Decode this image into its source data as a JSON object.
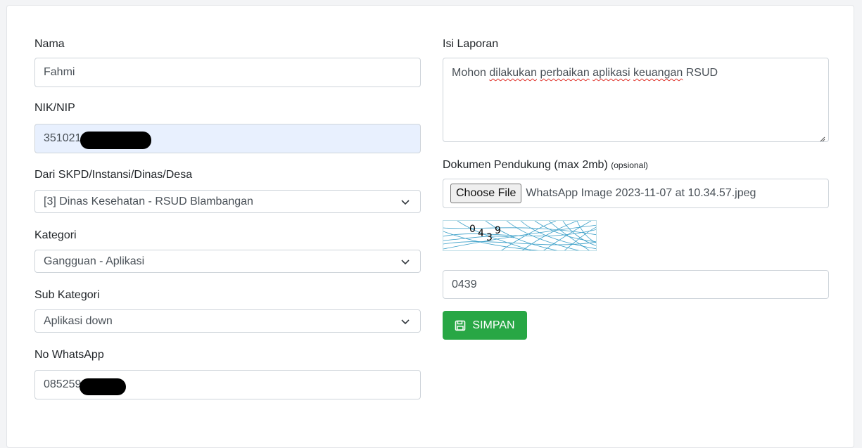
{
  "form": {
    "nama": {
      "label": "Nama",
      "value": "Fahmi"
    },
    "nik": {
      "label": "NIK/NIP",
      "value": "351021"
    },
    "skpd": {
      "label": "Dari SKPD/Instansi/Dinas/Desa",
      "value": "[3] Dinas Kesehatan - RSUD Blambangan"
    },
    "kategori": {
      "label": "Kategori",
      "value": "Gangguan - Aplikasi"
    },
    "sub_kategori": {
      "label": "Sub Kategori",
      "value": "Aplikasi down"
    },
    "whatsapp": {
      "label": "No WhatsApp",
      "value": "085259"
    },
    "isi_laporan": {
      "label": "Isi Laporan",
      "words": [
        "Mohon",
        "dilakukan",
        "perbaikan",
        "aplikasi",
        "keuangan",
        "RSUD"
      ]
    },
    "dokumen": {
      "label": "Dokumen Pendukung (max 2mb)",
      "label_note": "(opsional)",
      "button": "Choose File",
      "filename": "WhatsApp Image 2023-11-07 at 10.34.57.jpeg"
    },
    "captcha": {
      "image_text": "0439",
      "input_value": "0439"
    },
    "submit": {
      "label": "SIMPAN",
      "icon": "save-icon"
    }
  },
  "colors": {
    "accent": "#28a745",
    "autofill": "#e8f0fe"
  }
}
